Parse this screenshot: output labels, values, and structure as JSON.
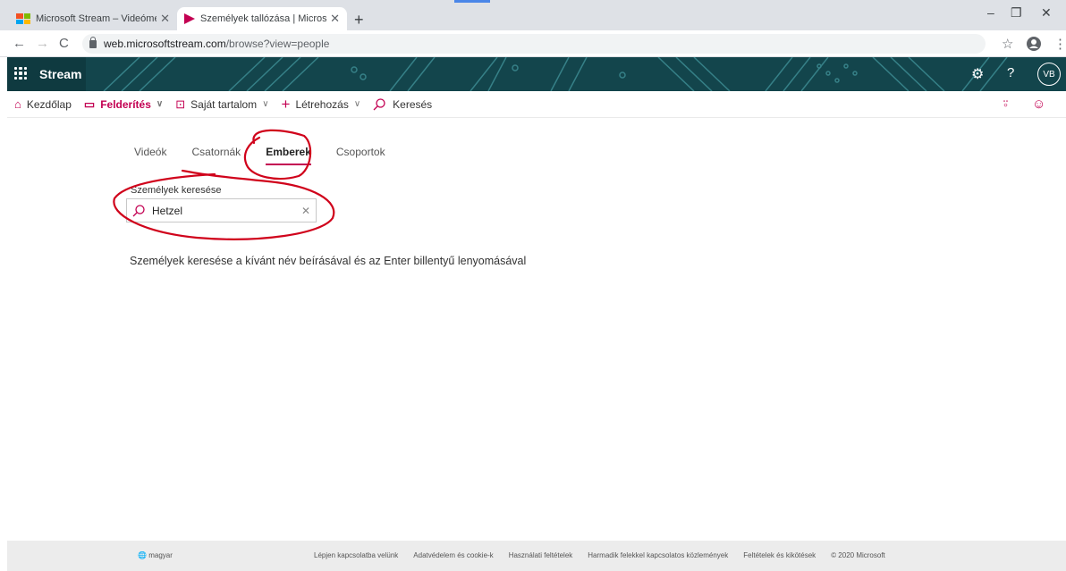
{
  "browser": {
    "tabs": [
      {
        "title": "Microsoft Stream – Videómegosz",
        "close": "✕"
      },
      {
        "title": "Személyek tallózása | Microsoft S",
        "close": "✕"
      }
    ],
    "new_tab": "+",
    "window_controls": {
      "minimize": "–",
      "restore": "❐",
      "close": "✕"
    },
    "url_host": "web.microsoftstream.com",
    "url_path": "/browse?view=people"
  },
  "banner": {
    "brand": "Stream",
    "avatar_initials": "VB",
    "help": "?"
  },
  "command_bar": {
    "items": [
      {
        "label": "Kezdőlap"
      },
      {
        "label": "Felderítés"
      },
      {
        "label": "Saját tartalom"
      },
      {
        "label": "Létrehozás"
      },
      {
        "label": "Keresés"
      }
    ]
  },
  "page": {
    "tabs": [
      "Videók",
      "Csatornák",
      "Emberek",
      "Csoportok"
    ],
    "active_tab": "Emberek",
    "search_label": "Személyek keresése",
    "search_value": "Hetzel",
    "hint": "Személyek keresése a kívánt név beírásával és az Enter billentyű lenyomásával"
  },
  "footer": {
    "language": "magyar",
    "links": [
      "Lépjen kapcsolatba velünk",
      "Adatvédelem és cookie-k",
      "Használati feltételek",
      "Harmadik felekkel kapcsolatos közlemények",
      "Feltételek és kikötések",
      "© 2020 Microsoft"
    ]
  },
  "colors": {
    "accent": "#c30052",
    "banner": "#0f3a40",
    "annotation": "#d0021b"
  }
}
